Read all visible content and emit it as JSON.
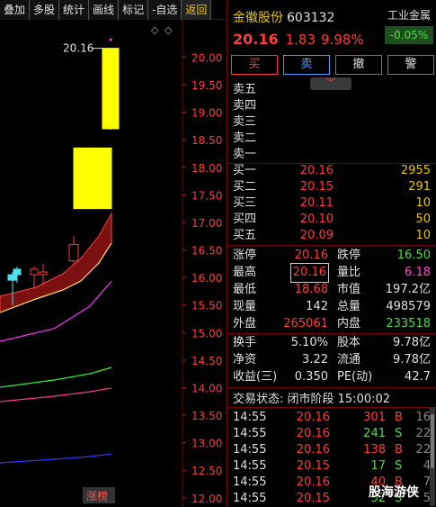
{
  "toolbar": {
    "items": [
      "叠加",
      "多股",
      "统计",
      "画线",
      "标记",
      "-自选",
      "返回"
    ]
  },
  "chart": {
    "y_ticks": [
      "20.00",
      "19.50",
      "19.00",
      "18.50",
      "18.00",
      "17.50",
      "17.00",
      "16.50",
      "16.00",
      "15.50",
      "15.00",
      "14.50",
      "14.00",
      "13.50",
      "13.00",
      "12.50",
      "12.00"
    ],
    "high_label": "20.16",
    "badge": "涨榜",
    "diamond": "◇",
    "limit_marker": "◇"
  },
  "chart_data": {
    "type": "candlestick",
    "y_range": [
      12.0,
      20.3
    ],
    "candles": [
      {
        "o": 15.95,
        "c": 16.05,
        "h": 16.1,
        "l": 15.5,
        "color": "cyan"
      },
      {
        "o": 16.05,
        "c": 16.15,
        "h": 16.2,
        "l": 15.9,
        "color": "cyan"
      },
      {
        "o": 16.05,
        "c": 16.15,
        "h": 16.2,
        "l": 15.8,
        "color": "red"
      },
      {
        "o": 16.05,
        "c": 16.1,
        "h": 16.25,
        "l": 15.85,
        "color": "red"
      },
      {
        "o": 16.3,
        "c": 16.6,
        "h": 16.75,
        "l": 16.25,
        "color": "red"
      },
      {
        "o": 17.25,
        "c": 18.35,
        "h": 18.35,
        "l": 17.25,
        "color": "yellow"
      },
      {
        "o": 18.7,
        "c": 20.16,
        "h": 20.16,
        "l": 18.68,
        "color": "yellow"
      }
    ]
  },
  "quote": {
    "name": "金徽股份",
    "code": "603132",
    "price": "20.16",
    "change": "1.83",
    "change_pct": "9.98%",
    "industry": "工业金属",
    "industry_pct": "-0.05%"
  },
  "actions": {
    "buy": "买",
    "sell": "卖",
    "cancel": "撤",
    "alert": "警",
    "collapse_glyph": "︾"
  },
  "order_book": {
    "asks": [
      {
        "label": "卖五",
        "price": "",
        "vol": ""
      },
      {
        "label": "卖四",
        "price": "",
        "vol": ""
      },
      {
        "label": "卖三",
        "price": "",
        "vol": ""
      },
      {
        "label": "卖二",
        "price": "",
        "vol": ""
      },
      {
        "label": "卖一",
        "price": "",
        "vol": ""
      }
    ],
    "bids": [
      {
        "label": "买一",
        "price": "20.16",
        "vol": "2955"
      },
      {
        "label": "买二",
        "price": "20.15",
        "vol": "291"
      },
      {
        "label": "买三",
        "price": "20.11",
        "vol": "10"
      },
      {
        "label": "买四",
        "price": "20.10",
        "vol": "50"
      },
      {
        "label": "买五",
        "price": "20.09",
        "vol": "10"
      }
    ]
  },
  "stats": {
    "zt_label": "涨停",
    "zt": "20.16",
    "dt_label": "跌停",
    "dt": "16.50",
    "high_label": "最高",
    "high": "20.16",
    "lb_label": "量比",
    "lb": "6.18",
    "low_label": "最低",
    "low": "18.68",
    "sz_label": "市值",
    "sz": "197.2亿",
    "xl_label": "现量",
    "xl": "142",
    "zl_label": "总量",
    "zl": "498579",
    "wp_label": "外盘",
    "wp": "265061",
    "np_label": "内盘",
    "np": "233518",
    "hs_label": "换手",
    "hs": "5.10%",
    "gb_label": "股本",
    "gb": "9.78亿",
    "jz_label": "净资",
    "jz": "3.22",
    "lt_label": "流通",
    "lt": "9.78亿",
    "sy_label": "收益(三)",
    "sy": "0.350",
    "pe_label": "PE(动)",
    "pe": "42.7"
  },
  "status": "交易状态: 闭市阶段 15:00:02",
  "ticks": [
    {
      "t": "14:55",
      "p": "20.16",
      "v": "301",
      "bs": "B",
      "n": "16"
    },
    {
      "t": "14:55",
      "p": "20.16",
      "v": "241",
      "bs": "S",
      "n": "22"
    },
    {
      "t": "14:55",
      "p": "20.16",
      "v": "138",
      "bs": "B",
      "n": "22"
    },
    {
      "t": "14:55",
      "p": "20.15",
      "v": "17",
      "bs": "S",
      "n": "4"
    },
    {
      "t": "14:55",
      "p": "20.16",
      "v": "40",
      "bs": "B",
      "n": "7"
    },
    {
      "t": "14:55",
      "p": "20.15",
      "v": "52",
      "bs": "S",
      "n": "5"
    }
  ],
  "watermark": "股海游侠",
  "colors": {
    "up": "#ff3b3b",
    "down": "#4ade4a",
    "yellow": "#e8c800",
    "cyan": "#4fe0f0"
  }
}
